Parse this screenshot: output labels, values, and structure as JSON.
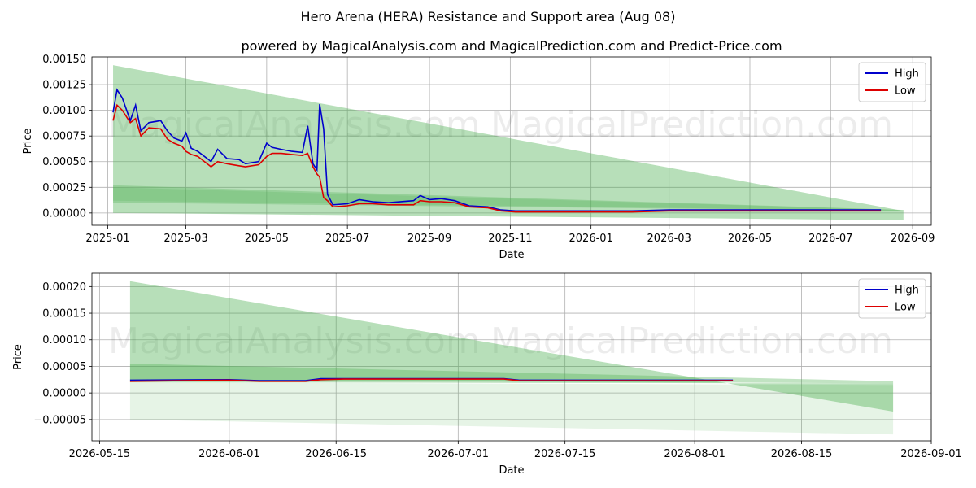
{
  "title": "Hero Arena (HERA) Resistance and Support area (Aug 08)",
  "subtitle": "powered by MagicalAnalysis.com and MagicalPrediction.com and Predict-Price.com",
  "watermarks": [
    "MagicalAnalysis.com",
    "MagicalPrediction.com"
  ],
  "colors": {
    "high": "#0000cc",
    "low": "#dd0000",
    "band": "#4caf50",
    "grid": "#b0b0b0"
  },
  "chart_data": [
    {
      "type": "line",
      "xlabel": "Date",
      "ylabel": "Price",
      "xlim": [
        "2024-12-20",
        "2026-09-15"
      ],
      "ylim": [
        -0.00012,
        0.00152
      ],
      "x_ticks": [
        "2025-01",
        "2025-03",
        "2025-05",
        "2025-07",
        "2025-09",
        "2025-11",
        "2026-01",
        "2026-03",
        "2026-05",
        "2026-07",
        "2026-09"
      ],
      "x_tick_dates": [
        "2025-01-01",
        "2025-03-01",
        "2025-05-01",
        "2025-07-01",
        "2025-09-01",
        "2025-11-01",
        "2026-01-01",
        "2026-03-01",
        "2026-05-01",
        "2026-07-01",
        "2026-09-01"
      ],
      "y_ticks": [
        "0.00000",
        "0.00025",
        "0.00050",
        "0.00075",
        "0.00100",
        "0.00125",
        "0.00150"
      ],
      "y_tick_values": [
        0,
        0.00025,
        0.0005,
        0.00075,
        0.001,
        0.00125,
        0.0015
      ],
      "grid": true,
      "legend": "top-right",
      "bands": [
        {
          "x": [
            "2025-01-05",
            "2026-08-25"
          ],
          "upper": [
            0.00144,
            2e-05
          ],
          "lower": [
            0.0,
            -7e-05
          ],
          "opacity": 0.4
        },
        {
          "x": [
            "2025-01-05",
            "2026-08-25"
          ],
          "upper": [
            0.00027,
            3e-05
          ],
          "lower": [
            0.0001,
            2e-05
          ],
          "opacity": 0.3
        },
        {
          "x": [
            "2025-01-05",
            "2026-08-25"
          ],
          "upper": [
            0.00025,
            3e-05
          ],
          "lower": [
            0.00012,
            2e-05
          ],
          "opacity": 0.2
        }
      ],
      "series": [
        {
          "name": "High",
          "x": [
            "2025-01-05",
            "2025-01-08",
            "2025-01-12",
            "2025-01-18",
            "2025-01-22",
            "2025-01-26",
            "2025-02-01",
            "2025-02-10",
            "2025-02-15",
            "2025-02-20",
            "2025-02-26",
            "2025-03-01",
            "2025-03-05",
            "2025-03-10",
            "2025-03-15",
            "2025-03-20",
            "2025-03-25",
            "2025-04-01",
            "2025-04-10",
            "2025-04-15",
            "2025-04-25",
            "2025-05-01",
            "2025-05-05",
            "2025-05-12",
            "2025-05-20",
            "2025-05-28",
            "2025-06-01",
            "2025-06-05",
            "2025-06-08",
            "2025-06-10",
            "2025-06-13",
            "2025-06-16",
            "2025-06-20",
            "2025-07-01",
            "2025-07-10",
            "2025-07-20",
            "2025-08-01",
            "2025-08-20",
            "2025-08-25",
            "2025-09-01",
            "2025-09-10",
            "2025-09-20",
            "2025-10-01",
            "2025-10-15",
            "2025-10-25",
            "2025-11-05",
            "2025-12-01",
            "2026-01-01",
            "2026-02-01",
            "2026-03-01",
            "2026-04-01",
            "2026-05-01",
            "2026-06-01",
            "2026-07-01",
            "2026-08-08"
          ],
          "values": [
            0.00098,
            0.0012,
            0.00112,
            0.0009,
            0.00105,
            0.0008,
            0.00088,
            0.0009,
            0.0008,
            0.00073,
            0.0007,
            0.00078,
            0.00063,
            0.0006,
            0.00055,
            0.0005,
            0.00062,
            0.00053,
            0.00052,
            0.00048,
            0.0005,
            0.00068,
            0.00064,
            0.00062,
            0.0006,
            0.00059,
            0.00085,
            0.00048,
            0.00042,
            0.00106,
            0.00082,
            0.00018,
            8e-05,
            9e-05,
            0.00013,
            0.00011,
            0.0001,
            0.00012,
            0.00017,
            0.00013,
            0.00014,
            0.00012,
            7e-05,
            6e-05,
            3e-05,
            2e-05,
            2e-05,
            2e-05,
            2e-05,
            3e-05,
            3e-05,
            3e-05,
            3e-05,
            3e-05,
            3e-05
          ]
        },
        {
          "name": "Low",
          "x": [
            "2025-01-05",
            "2025-01-08",
            "2025-01-12",
            "2025-01-18",
            "2025-01-22",
            "2025-01-26",
            "2025-02-01",
            "2025-02-10",
            "2025-02-15",
            "2025-02-20",
            "2025-02-26",
            "2025-03-01",
            "2025-03-05",
            "2025-03-10",
            "2025-03-15",
            "2025-03-20",
            "2025-03-25",
            "2025-04-01",
            "2025-04-10",
            "2025-04-15",
            "2025-04-25",
            "2025-05-01",
            "2025-05-05",
            "2025-05-12",
            "2025-05-20",
            "2025-05-28",
            "2025-06-01",
            "2025-06-05",
            "2025-06-08",
            "2025-06-10",
            "2025-06-13",
            "2025-06-16",
            "2025-06-20",
            "2025-07-01",
            "2025-07-10",
            "2025-07-20",
            "2025-08-01",
            "2025-08-20",
            "2025-08-25",
            "2025-09-01",
            "2025-09-10",
            "2025-09-20",
            "2025-10-01",
            "2025-10-15",
            "2025-10-25",
            "2025-11-05",
            "2025-12-01",
            "2026-01-01",
            "2026-02-01",
            "2026-03-01",
            "2026-04-01",
            "2026-05-01",
            "2026-06-01",
            "2026-07-01",
            "2026-08-08"
          ],
          "values": [
            0.0009,
            0.00105,
            0.001,
            0.00088,
            0.00092,
            0.00075,
            0.00083,
            0.00082,
            0.00072,
            0.00068,
            0.00065,
            0.0006,
            0.00057,
            0.00055,
            0.0005,
            0.00045,
            0.0005,
            0.00048,
            0.00046,
            0.00045,
            0.00047,
            0.00055,
            0.00058,
            0.00058,
            0.00057,
            0.00056,
            0.00058,
            0.00045,
            0.00038,
            0.00035,
            0.00015,
            0.00012,
            6e-05,
            7e-05,
            9e-05,
            9e-05,
            8e-05,
            8e-05,
            0.00012,
            0.00011,
            0.00011,
            0.0001,
            6e-05,
            5e-05,
            2e-05,
            1e-05,
            1e-05,
            1e-05,
            1e-05,
            2e-05,
            2e-05,
            2e-05,
            2e-05,
            2e-05,
            2e-05
          ]
        }
      ]
    },
    {
      "type": "line",
      "xlabel": "Date",
      "ylabel": "Price",
      "xlim": [
        "2026-05-14",
        "2026-09-01"
      ],
      "ylim": [
        -9e-05,
        0.000225
      ],
      "x_ticks": [
        "2026-05-15",
        "2026-06-01",
        "2026-06-15",
        "2026-07-01",
        "2026-07-15",
        "2026-08-01",
        "2026-08-15",
        "2026-09-01"
      ],
      "x_tick_dates": [
        "2026-05-15",
        "2026-06-01",
        "2026-06-15",
        "2026-07-01",
        "2026-07-15",
        "2026-08-01",
        "2026-08-15",
        "2026-09-01"
      ],
      "y_ticks": [
        "−0.00005",
        "0.00000",
        "0.00005",
        "0.00010",
        "0.00015",
        "0.00020"
      ],
      "y_tick_values": [
        -5e-05,
        0,
        5e-05,
        0.0001,
        0.00015,
        0.0002
      ],
      "grid": true,
      "legend": "top-right",
      "bands": [
        {
          "x": [
            "2026-05-19",
            "2026-08-27"
          ],
          "upper": [
            0.00021,
            -3.5e-05
          ],
          "lower": [
            2e-05,
            1.8e-05
          ],
          "opacity": 0.4
        },
        {
          "x": [
            "2026-05-19",
            "2026-08-27"
          ],
          "upper": [
            5.5e-05,
            2.2e-05
          ],
          "lower": [
            2.5e-05,
            1.8e-05
          ],
          "opacity": 0.35
        },
        {
          "x": [
            "2026-05-19",
            "2026-08-27"
          ],
          "upper": [
            2e-05,
            1.5e-05
          ],
          "lower": [
            -5e-05,
            -7.8e-05
          ],
          "opacity": 0.14
        }
      ],
      "series": [
        {
          "name": "High",
          "x": [
            "2026-05-19",
            "2026-06-01",
            "2026-06-05",
            "2026-06-11",
            "2026-06-13",
            "2026-06-16",
            "2026-07-01",
            "2026-07-07",
            "2026-07-09",
            "2026-07-20",
            "2026-08-01",
            "2026-08-06"
          ],
          "values": [
            2.4e-05,
            2.5e-05,
            2.3e-05,
            2.3e-05,
            2.7e-05,
            2.7e-05,
            2.7e-05,
            2.7e-05,
            2.4e-05,
            2.4e-05,
            2.4e-05,
            2.4e-05
          ]
        },
        {
          "name": "Low",
          "x": [
            "2026-05-19",
            "2026-06-01",
            "2026-06-05",
            "2026-06-11",
            "2026-06-13",
            "2026-06-16",
            "2026-07-01",
            "2026-07-07",
            "2026-07-09",
            "2026-07-20",
            "2026-08-01",
            "2026-08-06"
          ],
          "values": [
            2.2e-05,
            2.4e-05,
            2.2e-05,
            2.2e-05,
            2.5e-05,
            2.6e-05,
            2.6e-05,
            2.6e-05,
            2.3e-05,
            2.3e-05,
            2.3e-05,
            2.3e-05
          ]
        }
      ]
    }
  ]
}
